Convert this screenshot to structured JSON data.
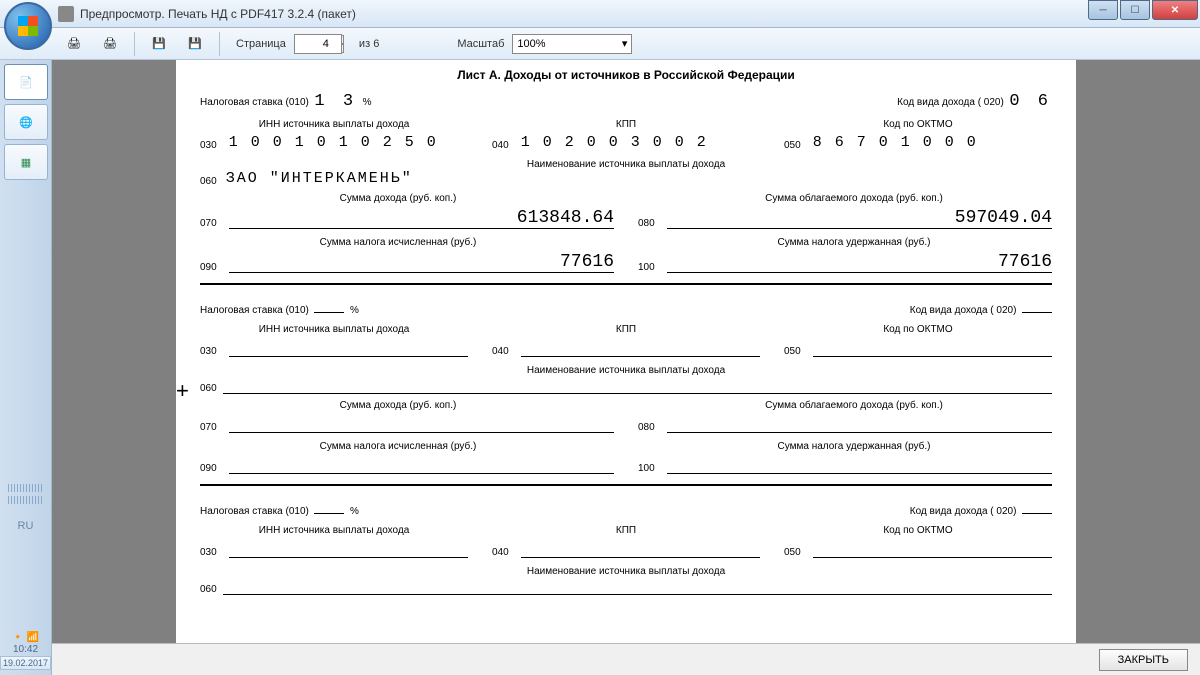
{
  "window": {
    "title": "Предпросмотр. Печать НД с PDF417 3.2.4 (пакет)"
  },
  "toolbar": {
    "page_label": "Страница",
    "page_value": "4",
    "of_label": "из",
    "total_pages": "6",
    "zoom_label": "Масштаб",
    "zoom_value": "100%"
  },
  "form": {
    "title": "Лист А. Доходы от источников в Российской Федерации",
    "rate_label": "Налоговая ставка (010)",
    "rate_pct": "%",
    "kind_label": "Код вида дохода ( 020)",
    "inn_hdr": "ИНН источника выплаты дохода",
    "kpp_hdr": "КПП",
    "oktmo_hdr": "Код по ОКТМО",
    "name_hdr": "Наименование источника выплаты дохода",
    "sum_income_hdr": "Сумма дохода (руб. коп.)",
    "sum_taxable_hdr": "Сумма облагаемого дохода (руб. коп.)",
    "sum_tax_calc_hdr": "Сумма налога исчисленная (руб.)",
    "sum_tax_held_hdr": "Сумма налога удержанная (руб.)",
    "codes": {
      "c030": "030",
      "c040": "040",
      "c050": "050",
      "c060": "060",
      "c070": "070",
      "c080": "080",
      "c090": "090",
      "c100": "100"
    },
    "section1": {
      "rate": "1 3",
      "kind": "0 6",
      "inn": "1 0 0 1 0 1 0 2 5 0",
      "kpp": "1 0 2 0 0 3 0 0 2",
      "oktmo": "8 6 7 0 1 0 0 0",
      "name": "ЗАО \"ИНТЕРКАМЕНЬ\"",
      "sum_income": "613848.64",
      "sum_taxable": "597049.04",
      "tax_calc": "77616",
      "tax_held": "77616"
    }
  },
  "footer": {
    "close": "ЗАКРЫТЬ"
  },
  "tray": {
    "lang": "RU",
    "time": "10:42",
    "date": "19.02.2017"
  }
}
